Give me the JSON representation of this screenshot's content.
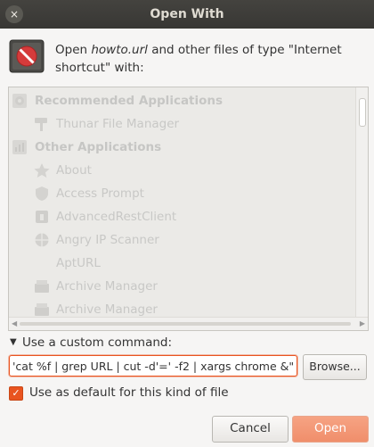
{
  "window": {
    "title": "Open With",
    "close_glyph": "×"
  },
  "header": {
    "prefix": "Open ",
    "filename": "howto.url",
    "suffix": " and other files of type \"Internet shortcut\" with:",
    "icon": "no-entry-icon"
  },
  "app_list": {
    "recommended_label": "Recommended Applications",
    "recommended": [
      {
        "label": "Thunar File Manager",
        "icon": "brush-icon"
      }
    ],
    "other_label": "Other Applications",
    "others": [
      {
        "label": "About",
        "icon": "star-icon"
      },
      {
        "label": "Access Prompt",
        "icon": "shield-icon"
      },
      {
        "label": "AdvancedRestClient",
        "icon": "rest-client-icon"
      },
      {
        "label": "Angry IP Scanner",
        "icon": "globe-icon"
      },
      {
        "label": "AptURL",
        "icon": ""
      },
      {
        "label": "Archive Manager",
        "icon": "archive-icon"
      },
      {
        "label": "Archive Manager",
        "icon": "archive-icon"
      }
    ]
  },
  "custom_command": {
    "expander_label": "Use a custom command:",
    "value": "'cat %f | grep URL | cut -d'=' -f2 | xargs chrome &\"",
    "browse_label": "Browse..."
  },
  "default_checkbox": {
    "label": "Use as default for this kind of file",
    "checked": true
  },
  "buttons": {
    "cancel": "Cancel",
    "open": "Open"
  },
  "colors": {
    "accent": "#e95420",
    "titlebar": "#3c3b37"
  }
}
